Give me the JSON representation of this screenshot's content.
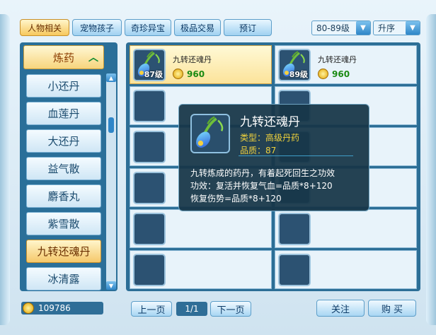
{
  "tabs": [
    "人物相关",
    "宠物孩子",
    "奇珍异宝",
    "极品交易",
    "预订"
  ],
  "filters": {
    "level": "80-89级",
    "sort": "升序"
  },
  "category": {
    "label": "炼药",
    "expanded_icon": "chevron-up-icon"
  },
  "items": [
    "小还丹",
    "血莲丹",
    "大还丹",
    "益气散",
    "麝香丸",
    "紫雪散",
    "九转还魂丹",
    "冰清露"
  ],
  "selected_item": "九转还魂丹",
  "listings": [
    {
      "name": "九转还魂丹",
      "level": "87级",
      "price": "960"
    },
    {
      "name": "九转还魂丹",
      "level": "89级",
      "price": "960"
    }
  ],
  "tooltip": {
    "title": "九转还魂丹",
    "type_line": "类型：高级丹药",
    "quality_line": "品质：87",
    "desc": [
      "九转炼成的药丹，有着起死回生之功效",
      "功效：复活并恢复气血=品质*8+120",
      "恢复伤势=品质*8+120"
    ]
  },
  "money": "109786",
  "pager": {
    "prev": "上一页",
    "page": "1/1",
    "next": "下一页"
  },
  "actions": {
    "follow": "关注",
    "buy": "购 买"
  },
  "colors": {
    "accent": "#2f86c8",
    "price": "#1a8a12",
    "tooltip_text": "#f0d23c"
  }
}
